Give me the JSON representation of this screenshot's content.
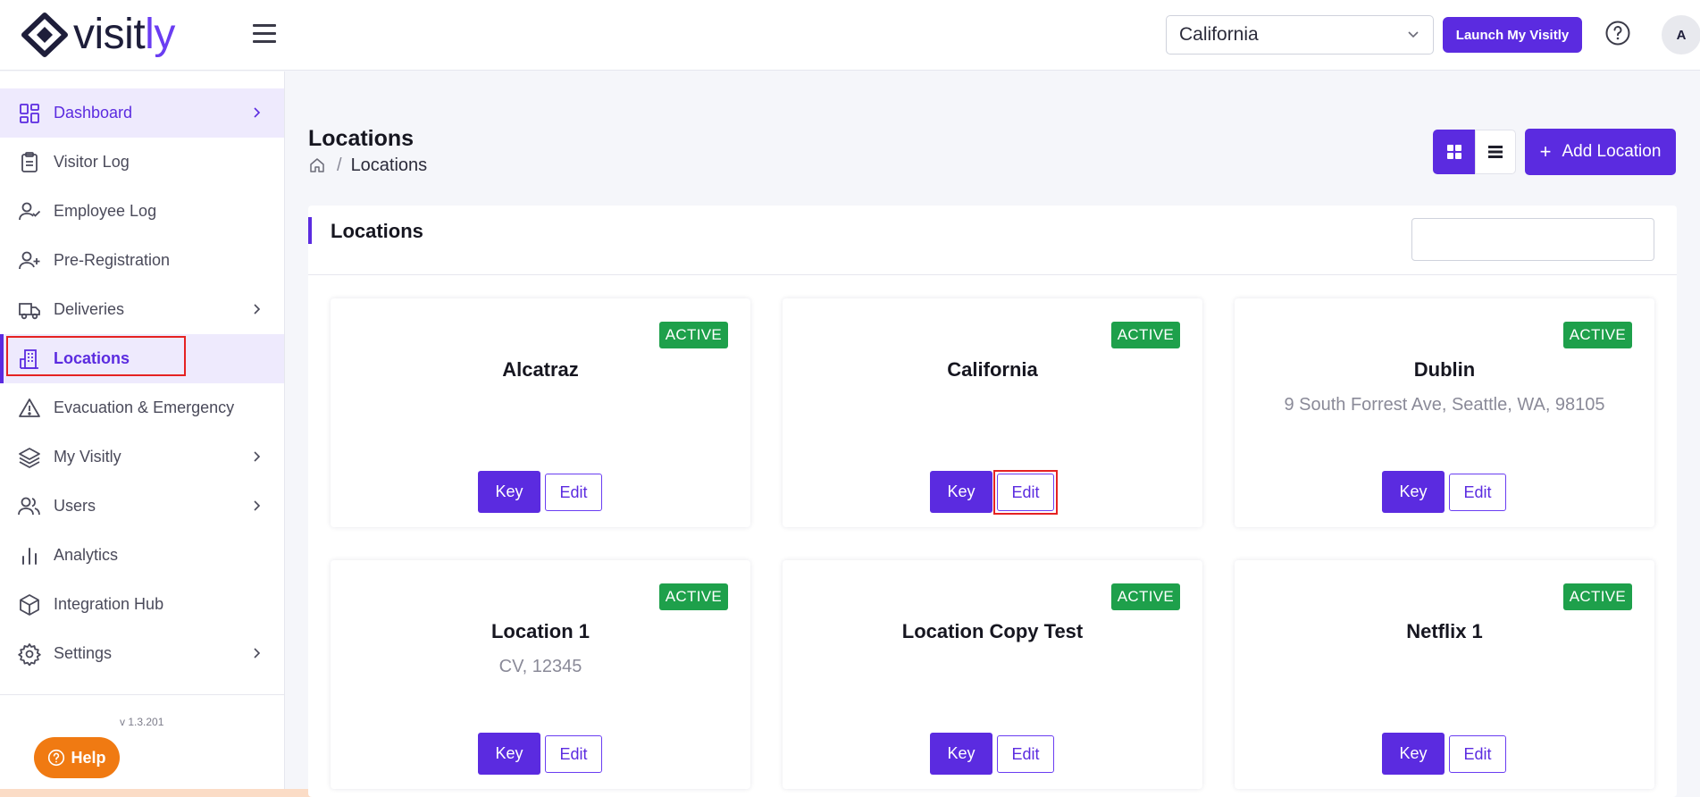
{
  "header": {
    "logo_text_main": "visit",
    "logo_text_accent": "ly",
    "location_select": "California",
    "launch_button": "Launch My Visitly",
    "avatar_initial": "A"
  },
  "sidebar": {
    "items": [
      {
        "label": "Dashboard",
        "icon": "dashboard-icon",
        "has_arrow": true
      },
      {
        "label": "Visitor Log",
        "icon": "clipboard-icon",
        "has_arrow": false
      },
      {
        "label": "Employee Log",
        "icon": "user-check-icon",
        "has_arrow": false
      },
      {
        "label": "Pre-Registration",
        "icon": "user-plus-icon",
        "has_arrow": false
      },
      {
        "label": "Deliveries",
        "icon": "truck-icon",
        "has_arrow": true
      },
      {
        "label": "Locations",
        "icon": "building-icon",
        "has_arrow": false
      },
      {
        "label": "Evacuation & Emergency",
        "icon": "warning-icon",
        "has_arrow": false
      },
      {
        "label": "My Visitly",
        "icon": "layers-icon",
        "has_arrow": true
      },
      {
        "label": "Users",
        "icon": "users-icon",
        "has_arrow": true
      },
      {
        "label": "Analytics",
        "icon": "bar-chart-icon",
        "has_arrow": false
      },
      {
        "label": "Integration Hub",
        "icon": "cube-icon",
        "has_arrow": false
      },
      {
        "label": "Settings",
        "icon": "gear-icon",
        "has_arrow": true
      }
    ],
    "version": "v 1.3.201",
    "help_button": "Help"
  },
  "main": {
    "page_title": "Locations",
    "breadcrumb_current": "Locations",
    "breadcrumb_separator": "/",
    "add_button": "Add Location",
    "add_button_icon": "+",
    "panel_title": "Locations",
    "search_value": "",
    "key_label": "Key",
    "edit_label": "Edit",
    "cards": [
      {
        "name": "Alcatraz",
        "address": "",
        "status": "ACTIVE"
      },
      {
        "name": "California",
        "address": "",
        "status": "ACTIVE"
      },
      {
        "name": "Dublin",
        "address": "9 South Forrest Ave, Seattle, WA, 98105",
        "status": "ACTIVE"
      },
      {
        "name": "Location 1",
        "address": "CV, 12345",
        "status": "ACTIVE"
      },
      {
        "name": "Location Copy Test",
        "address": "",
        "status": "ACTIVE"
      },
      {
        "name": "Netflix 1",
        "address": "",
        "status": "ACTIVE"
      }
    ]
  },
  "colors": {
    "accent": "#5b2be0",
    "active_badge": "#1ea04b",
    "help_button": "#f07a12",
    "highlight": "#e52222"
  }
}
